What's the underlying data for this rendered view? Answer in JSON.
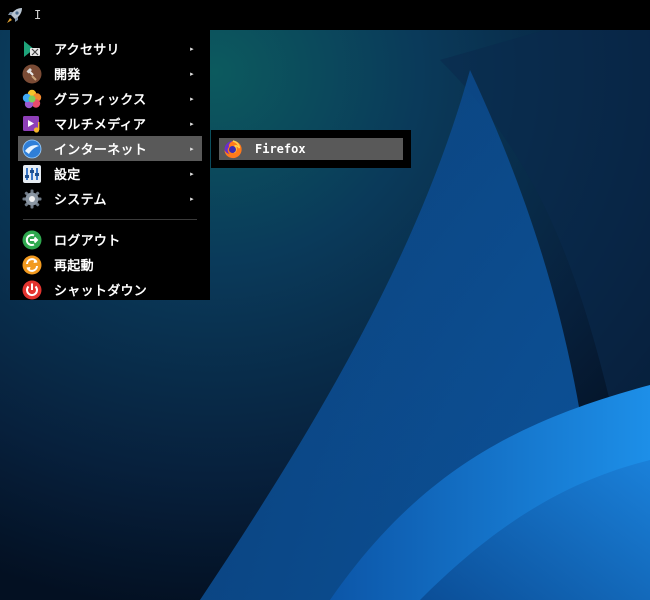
{
  "panel": {
    "launcher_icon": "rocket-icon",
    "indicator_text": "I"
  },
  "menu": {
    "items": [
      {
        "label": "アクセサリ",
        "icon": "accessories-icon",
        "has_submenu": true
      },
      {
        "label": "開発",
        "icon": "development-icon",
        "has_submenu": true
      },
      {
        "label": "グラフィックス",
        "icon": "graphics-icon",
        "has_submenu": true
      },
      {
        "label": "マルチメディア",
        "icon": "multimedia-icon",
        "has_submenu": true
      },
      {
        "label": "インターネット",
        "icon": "internet-icon",
        "has_submenu": true,
        "highlighted": true
      },
      {
        "label": "設定",
        "icon": "settings-icon",
        "has_submenu": true
      },
      {
        "label": "システム",
        "icon": "system-icon",
        "has_submenu": true
      }
    ],
    "actions": [
      {
        "label": "ログアウト",
        "icon": "logout-icon"
      },
      {
        "label": "再起動",
        "icon": "reboot-icon"
      },
      {
        "label": "シャットダウン",
        "icon": "shutdown-icon"
      }
    ],
    "submenu_arrow": "▸"
  },
  "submenu": {
    "items": [
      {
        "label": "Firefox",
        "icon": "firefox-icon",
        "highlighted": true
      }
    ]
  },
  "colors": {
    "menu_background": "#000000",
    "highlight": "#595959",
    "wallpaper_accent": "#1e88e5"
  }
}
